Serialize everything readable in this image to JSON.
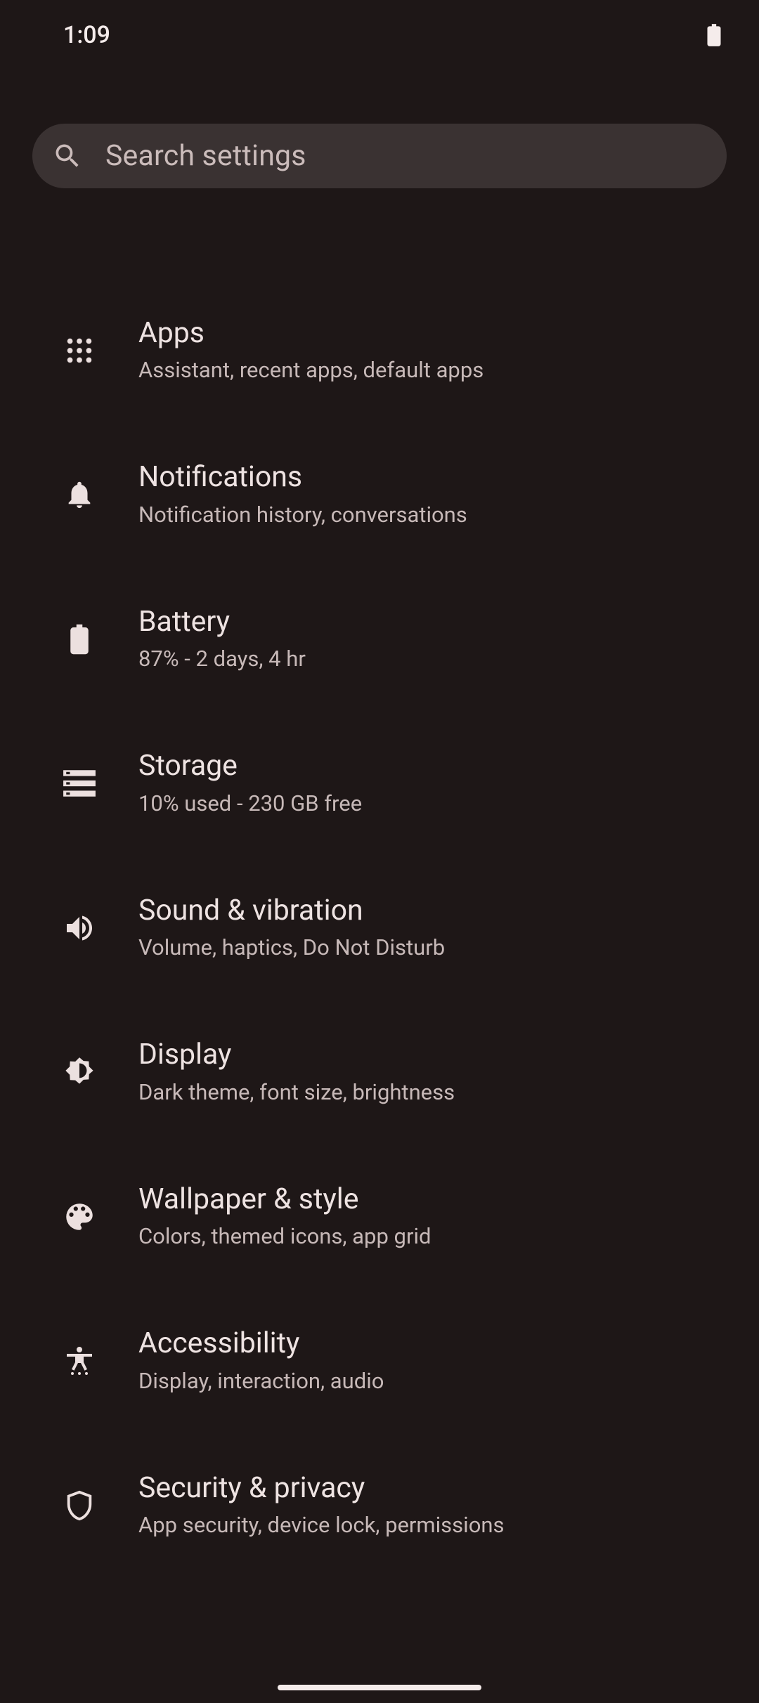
{
  "status": {
    "time": "1:09"
  },
  "search": {
    "placeholder": "Search settings"
  },
  "items": [
    {
      "title": "Apps",
      "subtitle": "Assistant, recent apps, default apps"
    },
    {
      "title": "Notifications",
      "subtitle": "Notification history, conversations"
    },
    {
      "title": "Battery",
      "subtitle": "87% - 2 days, 4 hr"
    },
    {
      "title": "Storage",
      "subtitle": "10% used - 230 GB free"
    },
    {
      "title": "Sound & vibration",
      "subtitle": "Volume, haptics, Do Not Disturb"
    },
    {
      "title": "Display",
      "subtitle": "Dark theme, font size, brightness"
    },
    {
      "title": "Wallpaper & style",
      "subtitle": "Colors, themed icons, app grid"
    },
    {
      "title": "Accessibility",
      "subtitle": "Display, interaction, audio"
    },
    {
      "title": "Security & privacy",
      "subtitle": "App security, device lock, permissions"
    }
  ]
}
